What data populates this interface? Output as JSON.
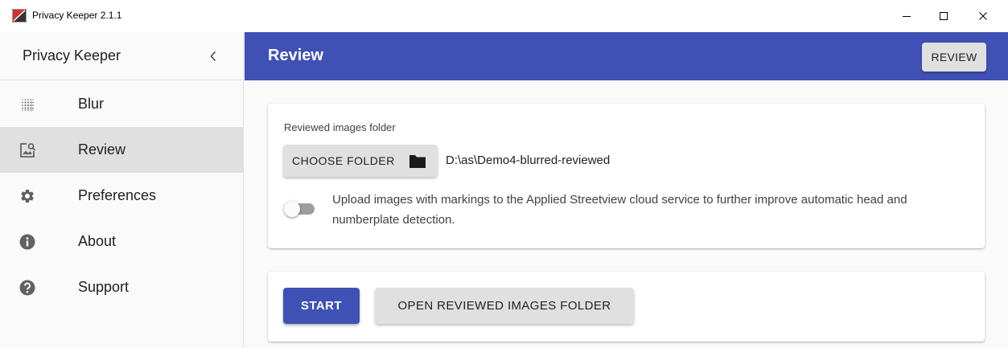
{
  "window": {
    "title": "Privacy Keeper 2.1.1",
    "controls": {
      "minimize": "–",
      "maximize": "☐",
      "close": "✕"
    }
  },
  "sidebar": {
    "brand": "Privacy Keeper",
    "collapse_icon": "chevron-left-icon",
    "items": [
      {
        "label": "Blur",
        "icon": "blur-grid-icon",
        "active": false
      },
      {
        "label": "Review",
        "icon": "image-search-icon",
        "active": true
      },
      {
        "label": "Preferences",
        "icon": "gear-icon",
        "active": false
      },
      {
        "label": "About",
        "icon": "info-icon",
        "active": false
      },
      {
        "label": "Support",
        "icon": "help-icon",
        "active": false
      }
    ]
  },
  "appbar": {
    "title": "Review",
    "action_label": "REVIEW",
    "color": "#3f51b5"
  },
  "folder_card": {
    "label": "Reviewed images folder",
    "choose_button": "CHOOSE FOLDER",
    "folder_icon": "folder-icon",
    "path": "D:\\as\\Demo4-blurred-reviewed",
    "upload_toggle": {
      "checked": false
    },
    "upload_text": "Upload images with markings to the Applied Streetview cloud service to further improve automatic head and numberplate detection."
  },
  "actions_card": {
    "start_label": "START",
    "open_label": "OPEN REVIEWED IMAGES FOLDER"
  }
}
